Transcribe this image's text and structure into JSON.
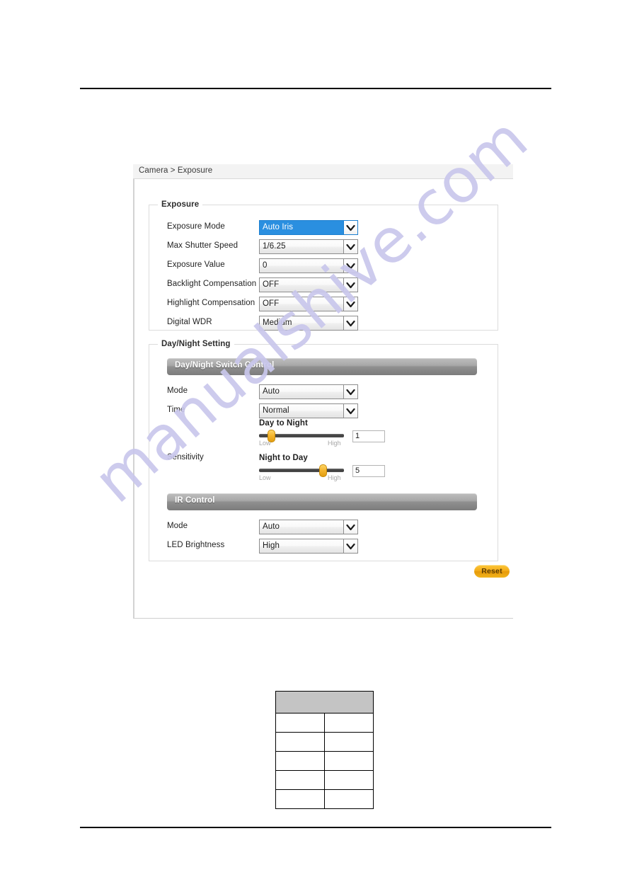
{
  "document": {
    "has_top_rule": true,
    "has_bottom_rule": true,
    "watermark_text": "manualshive.com",
    "watermark_color": "#c9c7ec"
  },
  "screenshot": {
    "breadcrumb": "Camera > Exposure",
    "exposure": {
      "legend": "Exposure",
      "rows": [
        {
          "label": "Exposure Mode",
          "value": "Auto Iris",
          "focused": true
        },
        {
          "label": "Max Shutter Speed",
          "value": "1/6.25",
          "focused": false
        },
        {
          "label": "Exposure Value",
          "value": "0",
          "focused": false
        },
        {
          "label": "Backlight Compensation",
          "value": "OFF",
          "focused": false
        },
        {
          "label": "Highlight Compensation",
          "value": "OFF",
          "focused": false
        },
        {
          "label": "Digital WDR",
          "value": "Medium",
          "focused": false
        }
      ]
    },
    "daynight": {
      "legend": "Day/Night Setting",
      "switch_control": {
        "bar_title": "Day/Night Switch Control",
        "mode_label": "Mode",
        "mode_value": "Auto",
        "time_label": "Time",
        "time_value": "Normal",
        "sensitivity_label": "Sensitivity",
        "day_to_night": {
          "title": "Day to Night",
          "value": "1",
          "low_label": "Low",
          "high_label": "High",
          "percent": 11
        },
        "night_to_day": {
          "title": "Night to Day",
          "value": "5",
          "low_label": "Low",
          "high_label": "High",
          "percent": 78
        }
      },
      "ir_control": {
        "bar_title": "IR Control",
        "mode_label": "Mode",
        "mode_value": "Auto",
        "led_label": "LED Brightness",
        "led_value": "High"
      }
    },
    "reset_label": "Reset",
    "accent_selected": "#2a8fe0",
    "accent_button": "#f4ab17"
  },
  "table": {
    "header_cells": [
      "",
      ""
    ],
    "rows": [
      [
        "",
        ""
      ],
      [
        "",
        ""
      ],
      [
        "",
        ""
      ],
      [
        "",
        ""
      ],
      [
        "",
        ""
      ]
    ]
  }
}
